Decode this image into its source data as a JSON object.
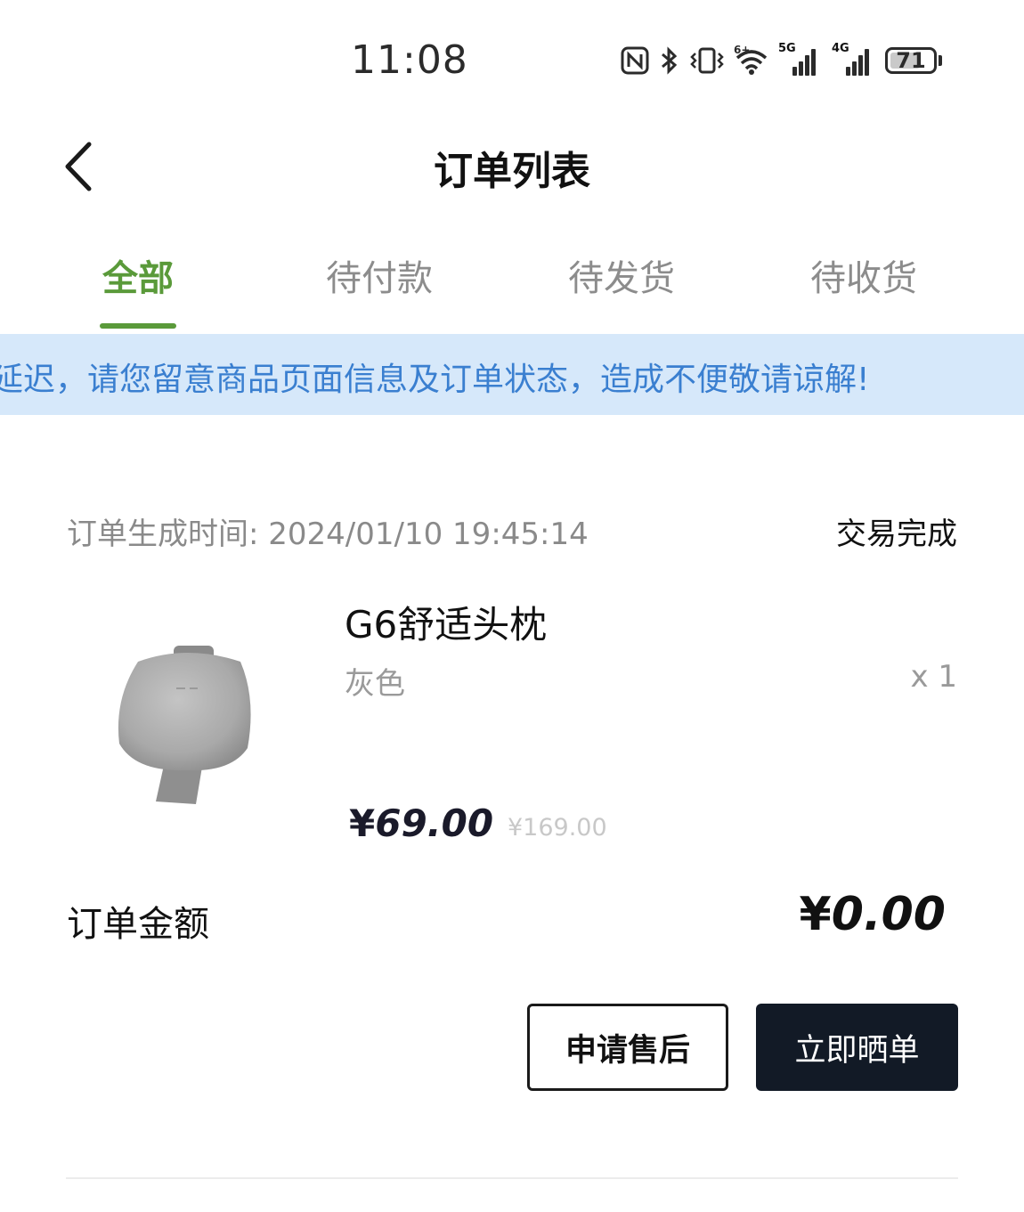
{
  "status_bar": {
    "time": "11:08",
    "network_5g_label": "5G",
    "network_4g_label": "4G",
    "wifi_label": "6+",
    "battery": "71",
    "battery_level": 0.71,
    "icons": [
      "nfc-icon",
      "bluetooth-icon",
      "vibrate-icon",
      "wifi-icon",
      "signal-5g-icon",
      "signal-4g-icon",
      "battery-icon"
    ]
  },
  "header": {
    "title": "订单列表",
    "back_icon": "chevron-left-icon"
  },
  "tabs": [
    {
      "label": "全部",
      "active": true
    },
    {
      "label": "待付款",
      "active": false
    },
    {
      "label": "待发货",
      "active": false
    },
    {
      "label": "待收货",
      "active": false
    }
  ],
  "notice": {
    "text": "延迟，请您留意商品页面信息及订单状态，造成不便敬请谅解!"
  },
  "order": {
    "time_label": "订单生成时间:",
    "time_value": "2024/01/10 19:45:14",
    "status": "交易完成",
    "product": {
      "name": "G6舒适头枕",
      "variant": "灰色",
      "quantity": "x 1",
      "price_symbol": "¥",
      "price": "69.00",
      "original_price": "¥169.00"
    },
    "amount_label": "订单金额",
    "amount_symbol": "¥",
    "amount_value": "0.00",
    "actions": {
      "after_sale": "申请售后",
      "share": "立即晒单"
    }
  },
  "colors": {
    "accent_green": "#5a9a3a",
    "notice_bg": "#d6e8fa",
    "notice_text": "#3a7fd0",
    "primary_button": "#121a26"
  }
}
